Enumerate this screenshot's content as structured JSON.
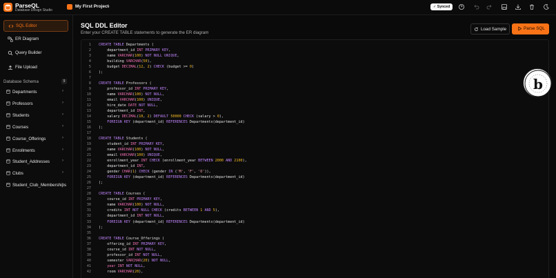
{
  "app": {
    "name": "ParseQL",
    "subtitle": "Database Design Studio"
  },
  "project": {
    "name": "My First Project"
  },
  "status": {
    "synced_label": "✓ Synced"
  },
  "nav": [
    {
      "label": "SQL Editor",
      "icon": "code-icon"
    },
    {
      "label": "ER Diagram",
      "icon": "diagram-icon"
    },
    {
      "label": "Query Builder",
      "icon": "search-icon"
    },
    {
      "label": "File Upload",
      "icon": "upload-icon"
    }
  ],
  "schema": {
    "heading": "Database Schema",
    "count": "9",
    "tables": [
      "Departments",
      "Professors",
      "Students",
      "Courses",
      "Course_Offerings",
      "Enrollments",
      "Student_Addresses",
      "Clubs",
      "Student_Club_Memberships"
    ]
  },
  "editor": {
    "title": "SQL DDL Editor",
    "subtitle": "Enter your CREATE TABLE statements to generate the ER diagram",
    "load_sample_label": "Load Sample",
    "parse_label": "Parse SQL",
    "lines": [
      "CREATE TABLE Departments (",
      "    department_id INT PRIMARY KEY,",
      "    name VARCHAR(100) NOT NULL UNIQUE,",
      "    building VARCHAR(50),",
      "    budget DECIMAL(12, 2) CHECK (budget >= 0)",
      ");",
      "",
      "CREATE TABLE Professors (",
      "    professor_id INT PRIMARY KEY,",
      "    name VARCHAR(100) NOT NULL,",
      "    email VARCHAR(100) UNIQUE,",
      "    hire_date DATE NOT NULL,",
      "    department_id INT,",
      "    salary DECIMAL(10, 2) DEFAULT 50000 CHECK (salary > 0),",
      "    FOREIGN KEY (department_id) REFERENCES Departments(department_id)",
      ");",
      "",
      "CREATE TABLE Students (",
      "    student_id INT PRIMARY KEY,",
      "    name VARCHAR(100) NOT NULL,",
      "    email VARCHAR(100) UNIQUE,",
      "    enrollment_year INT CHECK (enrollment_year BETWEEN 2000 AND 2100),",
      "    department_id INT,",
      "    gender CHAR(1) CHECK (gender IN ('M', 'F', 'O')),",
      "    FOREIGN KEY (department_id) REFERENCES Departments(department_id)",
      ");",
      "",
      "CREATE TABLE Courses (",
      "    course_id INT PRIMARY KEY,",
      "    name VARCHAR(100) NOT NULL,",
      "    credits INT NOT NULL CHECK (credits BETWEEN 1 AND 5),",
      "    department_id INT NOT NULL,",
      "    FOREIGN KEY (department_id) REFERENCES Departments(department_id)",
      ");",
      "",
      "CREATE TABLE Course_Offerings (",
      "    offering_id INT PRIMARY KEY,",
      "    course_id INT NOT NULL,",
      "    professor_id INT NOT NULL,",
      "    semester VARCHAR(20) NOT NULL,",
      "    year INT NOT NULL,",
      "    room VARCHAR(20),"
    ]
  },
  "colors": {
    "accent": "#f97316",
    "keyword": "#c084fc",
    "type": "#f472b6",
    "number": "#fbbf24"
  }
}
